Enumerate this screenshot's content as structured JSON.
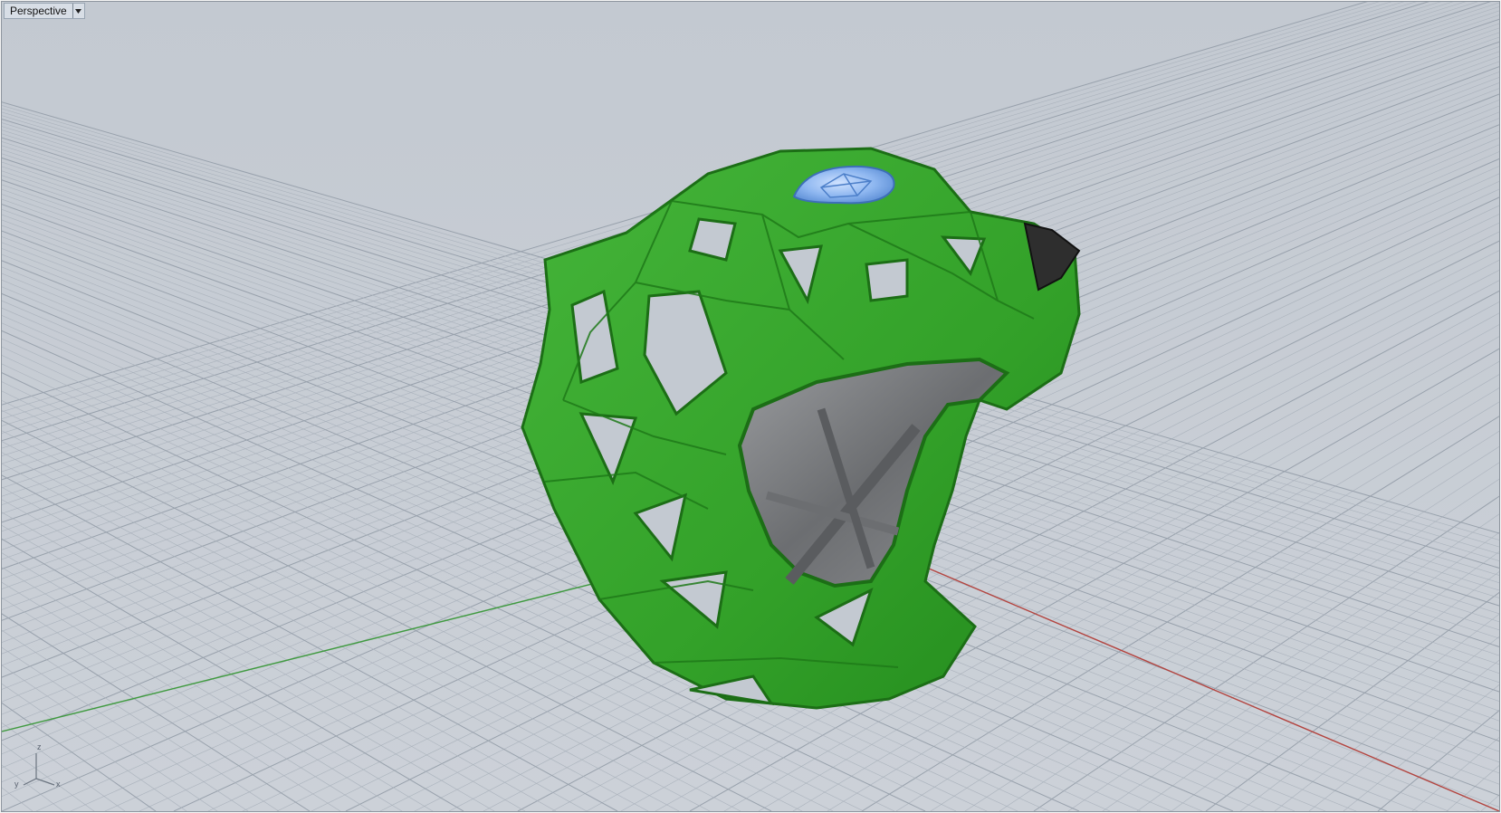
{
  "viewport": {
    "title": "Perspective",
    "menu_icon": "chevron-down-icon",
    "background_color": "#c6ccd4",
    "grid_color": "#aab2bc",
    "grid_major_color": "#98a1ac"
  },
  "axes": {
    "x_axis_color": "#b3443f",
    "y_axis_color": "#3f9a3f"
  },
  "axis_widget": {
    "z_label": "z",
    "y_label": "y",
    "x_label": "x"
  },
  "model": {
    "body_color": "#35a32b",
    "body_dark_color": "#1f7a19",
    "inner_color": "#7b7d80",
    "gem_color": "#8fb8f2",
    "nose_color": "#2e2e2e"
  }
}
